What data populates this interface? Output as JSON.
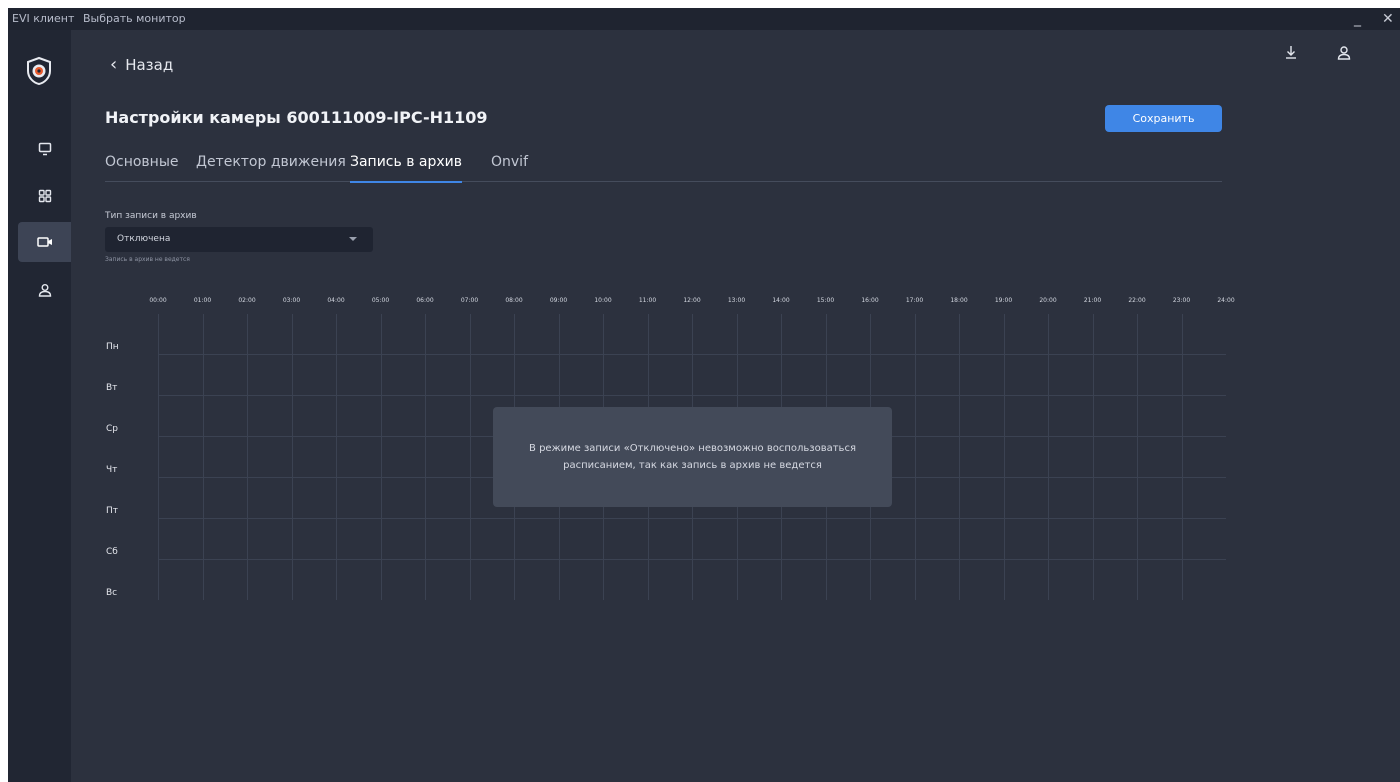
{
  "titlebar": {
    "app_name": "EVI клиент",
    "monitor_menu": "Выбрать монитор",
    "minimize": "_",
    "close": "✕"
  },
  "sidebar": {
    "items": [
      {
        "icon": "monitor-icon",
        "active": false
      },
      {
        "icon": "grid-icon",
        "active": false
      },
      {
        "icon": "camera-icon",
        "active": true
      },
      {
        "icon": "user-icon",
        "active": false
      }
    ]
  },
  "header": {
    "back_label": "Назад",
    "top_icons": [
      "download-icon",
      "user-icon"
    ]
  },
  "page": {
    "title": "Настройки камеры 600111009-IPC-H1109",
    "save_label": "Сохранить"
  },
  "tabs": [
    {
      "label": "Основные",
      "active": false
    },
    {
      "label": "Детектор движения",
      "active": false
    },
    {
      "label": "Запись в архив",
      "active": true
    },
    {
      "label": "Onvif",
      "active": false
    }
  ],
  "archive": {
    "type_label": "Тип записи в архив",
    "type_value": "Отключена",
    "hint": "Запись в архив не ведется"
  },
  "schedule": {
    "hours": [
      "00:00",
      "01:00",
      "02:00",
      "03:00",
      "04:00",
      "05:00",
      "06:00",
      "07:00",
      "08:00",
      "09:00",
      "10:00",
      "11:00",
      "12:00",
      "13:00",
      "14:00",
      "15:00",
      "16:00",
      "17:00",
      "18:00",
      "19:00",
      "20:00",
      "21:00",
      "22:00",
      "23:00",
      "24:00"
    ],
    "days": [
      "Пн",
      "Вт",
      "Ср",
      "Чт",
      "Пт",
      "Сб",
      "Вс"
    ],
    "disabled_message": "В режиме записи «Отключено» невозможно воспользоваться расписанием, так как запись в архив не ведется"
  },
  "colors": {
    "background": "#2c313e",
    "sidebar": "#212633",
    "accent": "#3f86e6",
    "overlay": "#434a59"
  }
}
